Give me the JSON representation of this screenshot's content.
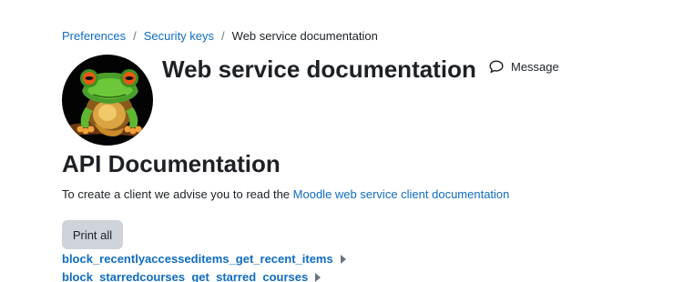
{
  "breadcrumb": {
    "items": [
      {
        "label": "Preferences"
      },
      {
        "label": "Security keys"
      }
    ],
    "separator": "/",
    "current": "Web service documentation"
  },
  "header": {
    "avatar_icon": "frog-profile-picture",
    "title": "Web service documentation",
    "message_icon": "speech-bubble-icon",
    "message_label": "Message"
  },
  "main": {
    "heading": "API Documentation",
    "intro_text": "To create a client we advise you to read the ",
    "intro_link": "Moodle web service client documentation",
    "print_all_label": "Print all",
    "functions": [
      {
        "name": "block_recentlyaccesseditems_get_recent_items"
      },
      {
        "name": "block_starredcourses_get_starred_courses"
      }
    ]
  },
  "colors": {
    "link": "#0f6cbf",
    "text": "#1d2125",
    "button_bg": "#ced4da",
    "muted": "#6a737b"
  }
}
